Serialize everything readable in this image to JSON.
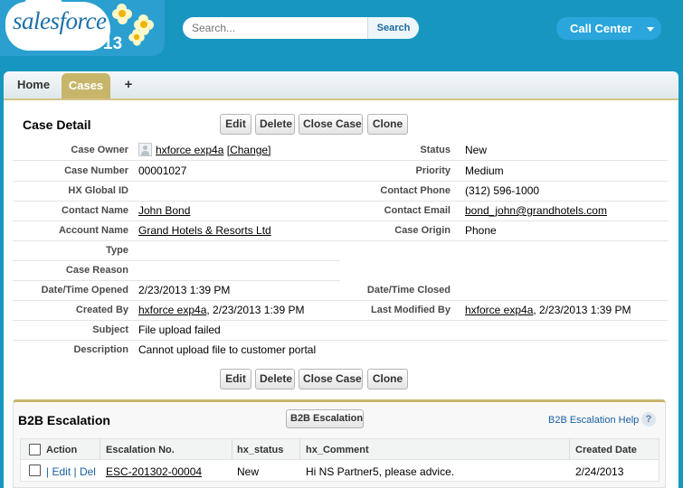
{
  "header": {
    "logo_text": "salesforce",
    "logo_number": "13",
    "search_placeholder": "Search...",
    "search_button": "Search",
    "call_center": "Call Center"
  },
  "tabs": [
    {
      "label": "Home",
      "active": false
    },
    {
      "label": "Cases",
      "active": true
    },
    {
      "label": "+",
      "active": false
    }
  ],
  "case_detail": {
    "title": "Case Detail",
    "buttons": [
      "Edit",
      "Delete",
      "Close Case",
      "Clone"
    ],
    "fields": {
      "case_owner": {
        "label": "Case Owner",
        "value": "hxforce exp4a",
        "change": "[Change]"
      },
      "status": {
        "label": "Status",
        "value": "New"
      },
      "case_number": {
        "label": "Case Number",
        "value": "00001027"
      },
      "priority": {
        "label": "Priority",
        "value": "Medium"
      },
      "hx_global_id": {
        "label": "HX Global ID",
        "value": ""
      },
      "contact_phone": {
        "label": "Contact Phone",
        "value": "(312) 596-1000"
      },
      "contact_name": {
        "label": "Contact Name",
        "value": "John Bond"
      },
      "contact_email": {
        "label": "Contact Email",
        "value": "bond_john@grandhotels.com"
      },
      "account_name": {
        "label": "Account Name",
        "value": "Grand Hotels & Resorts Ltd"
      },
      "case_origin": {
        "label": "Case Origin",
        "value": "Phone"
      },
      "type": {
        "label": "Type",
        "value": ""
      },
      "case_reason": {
        "label": "Case Reason",
        "value": ""
      },
      "date_opened": {
        "label": "Date/Time Opened",
        "value": "2/23/2013 1:39 PM"
      },
      "date_closed": {
        "label": "Date/Time Closed",
        "value": ""
      },
      "created_by": {
        "label": "Created By",
        "user": "hxforce exp4a",
        "date": ", 2/23/2013 1:39 PM"
      },
      "last_modified_by": {
        "label": "Last Modified By",
        "user": "hxforce exp4a",
        "date": ", 2/23/2013 1:39 PM"
      },
      "subject": {
        "label": "Subject",
        "value": "File upload failed"
      },
      "description": {
        "label": "Description",
        "value": "Cannot upload file to customer portal"
      }
    }
  },
  "b2b": {
    "title": "B2B Escalation",
    "new_button": "B2B Escalation",
    "help": "B2B Escalation Help",
    "help_icon": "?",
    "columns": [
      "Action",
      "Escalation No.",
      "hx_status",
      "hx_Comment",
      "Created Date"
    ],
    "rows": [
      {
        "edit": "Edit",
        "del": "Del",
        "sep": "|",
        "number": "ESC-201302-00004",
        "status": "New",
        "comment": "Hi NS Partner5, please advice.",
        "created": "2/24/2013"
      }
    ]
  },
  "colors": {
    "header_bg": "#1797c0",
    "tab_active": "#c7b56a",
    "link_blue": "#1a5fa0"
  }
}
